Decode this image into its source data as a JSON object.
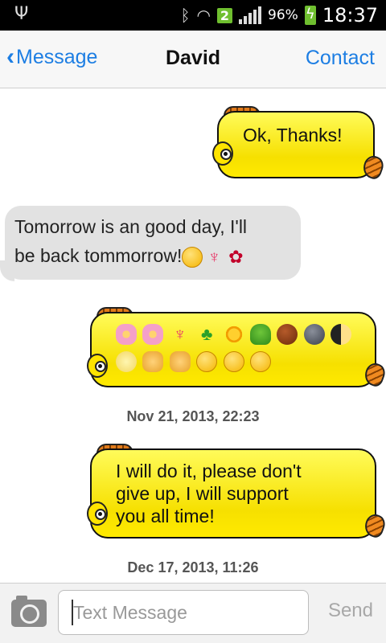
{
  "status_bar": {
    "usb_icon": "usb-icon",
    "bluetooth_icon": "bluetooth-icon",
    "wifi_icon": "wifi-icon",
    "notification_count": "2",
    "battery_percent": "96%",
    "time": "18:37"
  },
  "header": {
    "back_label": "Message",
    "title": "David",
    "contact_label": "Contact"
  },
  "messages": [
    {
      "direction": "outgoing",
      "text": "Ok, Thanks!"
    },
    {
      "direction": "incoming",
      "text_line1": "Tomorrow is an good day, I'll",
      "text_line2": "be back tommorrow!"
    },
    {
      "direction": "outgoing",
      "emoji_row1": [
        "bouquet",
        "cherry-blossom",
        "tulip",
        "four-leaf-clover",
        "sunflower",
        "tree",
        "chestnut",
        "new-moon-face",
        "first-quarter-moon"
      ],
      "emoji_row2": [
        "full-moon-face",
        "crying-cat",
        "weary-cat",
        "grinning",
        "smiling",
        "smiling-blush"
      ]
    },
    {
      "direction": "outgoing",
      "text_line1": "I will do it, please don't",
      "text_line2": "give up, I will support",
      "text_line3": "you all time!"
    }
  ],
  "timestamps": [
    "Nov 21, 2013, 22:23",
    "Dec 17, 2013, 11:26"
  ],
  "composer": {
    "placeholder": "Text Message",
    "send_label": "Send",
    "camera_icon": "camera-icon"
  },
  "colors": {
    "accent": "#1d7ee3",
    "bubble_out": "#ffea00",
    "bubble_in": "#e2e2e2"
  }
}
